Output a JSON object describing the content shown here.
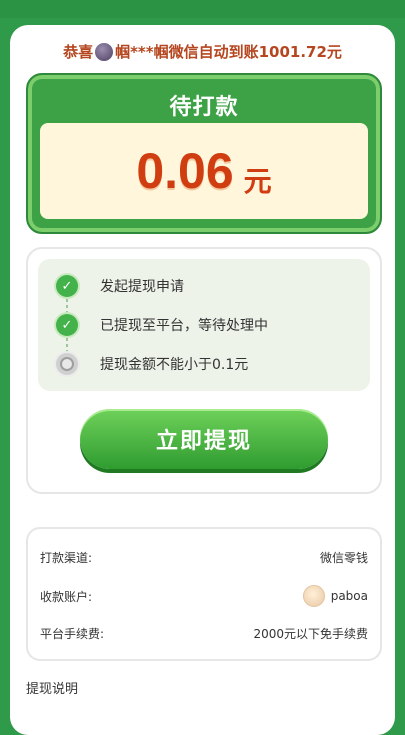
{
  "notice": {
    "prefix": "恭喜",
    "middle": "帼***帼微信自动到账1001.72元"
  },
  "amount": {
    "title": "待打款",
    "value": "0.06",
    "unit": "元"
  },
  "steps": [
    {
      "label": "发起提现申请",
      "status": "done"
    },
    {
      "label": "已提现至平台，等待处理中",
      "status": "done"
    },
    {
      "label": "提现金额不能小于0.1元",
      "status": "pending"
    }
  ],
  "withdraw_button": "立即提现",
  "info": {
    "channel_label": "打款渠道:",
    "channel_value": "微信零钱",
    "account_label": "收款账户:",
    "account_value": "paboa",
    "fee_label": "平台手续费:",
    "fee_value": "2000元以下免手续费"
  },
  "explain_title": "提现说明",
  "colors": {
    "brand_green": "#2e9a4a",
    "amount_red": "#cf3d10",
    "notice_orange": "#b5461f"
  }
}
